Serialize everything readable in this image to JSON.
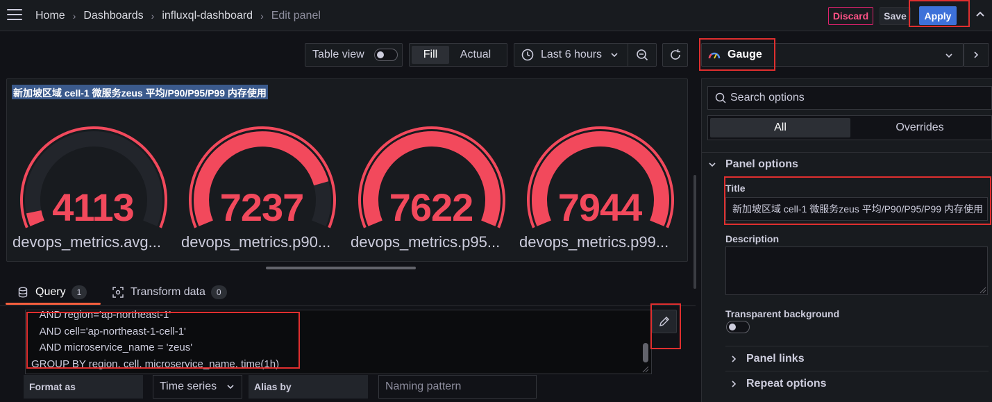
{
  "breadcrumb": {
    "items": [
      "Home",
      "Dashboards",
      "influxql-dashboard"
    ],
    "current": "Edit panel",
    "separator": "›"
  },
  "actions": {
    "discard": "Discard",
    "save": "Save",
    "apply": "Apply"
  },
  "toolbar": {
    "table_view_label": "Table view",
    "fill_label": "Fill",
    "actual_label": "Actual",
    "time_range": "Last 6 hours"
  },
  "visualization": {
    "name": "Gauge"
  },
  "panel": {
    "title": "新加坡区域 cell-1 微服务zeus 平均/P90/P95/P99 内存使用",
    "gauges": [
      {
        "value": "4113",
        "label": "devops_metrics.avg...",
        "fraction": 0.05
      },
      {
        "value": "7237",
        "label": "devops_metrics.p90...",
        "fraction": 0.83
      },
      {
        "value": "7622",
        "label": "devops_metrics.p95...",
        "fraction": 1.0
      },
      {
        "value": "7944",
        "label": "devops_metrics.p99...",
        "fraction": 1.0
      }
    ],
    "gauge_color": "#f2495c",
    "gauge_track_color": "#22252b"
  },
  "query_tabs": {
    "query_label": "Query",
    "query_count": "1",
    "transform_label": "Transform data",
    "transform_count": "0"
  },
  "query_editor": {
    "lines": [
      "   AND region='ap-northeast-1'",
      "   AND cell='ap-northeast-1-cell-1'",
      "   AND microservice_name = 'zeus'",
      "GROUP BY region, cell, microservice_name, time(1h)"
    ]
  },
  "query_options": {
    "format_as_label": "Format as",
    "format_as_value": "Time series",
    "alias_by_label": "Alias by",
    "naming_pattern_placeholder": "Naming pattern"
  },
  "options_pane": {
    "search_placeholder": "Search options",
    "tab_all": "All",
    "tab_overrides": "Overrides",
    "panel_options_header": "Panel options",
    "title_label": "Title",
    "title_value": "新加坡区域 cell-1 微服务zeus 平均/P90/P95/P99 内存使用",
    "description_label": "Description",
    "transparent_label": "Transparent background",
    "panel_links": "Panel links",
    "repeat_options": "Repeat options"
  }
}
